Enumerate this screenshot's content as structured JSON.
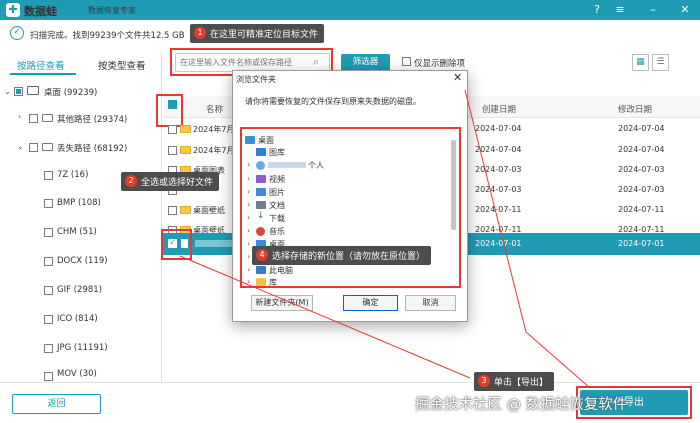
{
  "app": {
    "name": "数据蛙",
    "subtitle": "数据恢复专家",
    "window_buttons": [
      "question-icon",
      "menu-icon",
      "minimize-icon",
      "close-icon"
    ]
  },
  "status": {
    "text": "扫描完成。找到99239个文件共12.5 GB"
  },
  "tips": {
    "search": {
      "num": "1",
      "text": "在这里可精准定位目标文件"
    },
    "select": {
      "num": "2",
      "text": "全选或选择好文件"
    },
    "export": {
      "num": "3",
      "text": "单击【导出】"
    },
    "location": {
      "num": "4",
      "text": "选择存储的新位置（请勿放在原位置）"
    }
  },
  "sidebar": {
    "tab_path": "按路径查看",
    "tab_type": "按类型查看",
    "tree": [
      {
        "label": "桌面 (99239)"
      },
      {
        "label": "其他路径 (29374)"
      },
      {
        "label": "丢失路径 (68192)"
      },
      {
        "label": "7Z (16)"
      },
      {
        "label": "BMP (108)"
      },
      {
        "label": "CHM (51)"
      },
      {
        "label": "DOCX (119)"
      },
      {
        "label": "GIF (2981)"
      },
      {
        "label": "ICO (814)"
      },
      {
        "label": "JPG (11191)"
      },
      {
        "label": "MOV (30)"
      }
    ]
  },
  "toolbar": {
    "search_placeholder": "在这里输入文件名称或保存路径",
    "filter_label": "筛选器",
    "deleted_only_label": "仅显示删除项"
  },
  "table": {
    "headers": {
      "name": "名称",
      "created": "创建日期",
      "modified": "修改日期"
    },
    "rows": [
      {
        "name": "2024年7月",
        "created": "2024-07-04",
        "modified": "2024-07-04"
      },
      {
        "name": "2024年7月",
        "created": "2024-07-04",
        "modified": "2024-07-04"
      },
      {
        "name": "桌面图表",
        "created": "2024-07-03",
        "modified": "2024-07-03"
      },
      {
        "name": "",
        "created": "2024-07-03",
        "modified": "2024-07-03"
      },
      {
        "name": "桌面壁纸",
        "created": "2024-07-11",
        "modified": "2024-07-11"
      },
      {
        "name": "桌面壁纸",
        "created": "2024-07-11",
        "modified": "2024-07-11"
      },
      {
        "name": "",
        "created": "2024-07-01",
        "modified": "2024-07-01"
      }
    ]
  },
  "dialog": {
    "title": "浏览文件夹",
    "message": "请你将需要恢复的文件保存到原来失数据的磁盘。",
    "nodes": [
      {
        "label": "桌面",
        "icon": "desktop-icon"
      },
      {
        "label": "图库",
        "icon": "gallery-icon"
      },
      {
        "label": "个人",
        "icon": "user-icon"
      },
      {
        "label": "视频",
        "icon": "video-icon"
      },
      {
        "label": "图片",
        "icon": "picture-icon"
      },
      {
        "label": "文档",
        "icon": "document-icon"
      },
      {
        "label": "下载",
        "icon": "download-icon"
      },
      {
        "label": "音乐",
        "icon": "music-icon"
      },
      {
        "label": "桌面",
        "icon": "desktop-icon"
      },
      {
        "label": "",
        "icon": "folder-icon"
      },
      {
        "label": "此电脑",
        "icon": "computer-icon"
      },
      {
        "label": "库",
        "icon": "library-icon"
      }
    ],
    "new_folder_label": "新建文件夹(M)",
    "ok_label": "确定",
    "cancel_label": "取消"
  },
  "footer": {
    "back_label": "返回",
    "export_label": "导出",
    "watermark": "掘金技术社区 @ 数据蛙恢复软件"
  },
  "colors": {
    "accent": "#1f9bb3",
    "annotation_red": "#e53a32",
    "tip_bg": "#4d4d4d"
  }
}
